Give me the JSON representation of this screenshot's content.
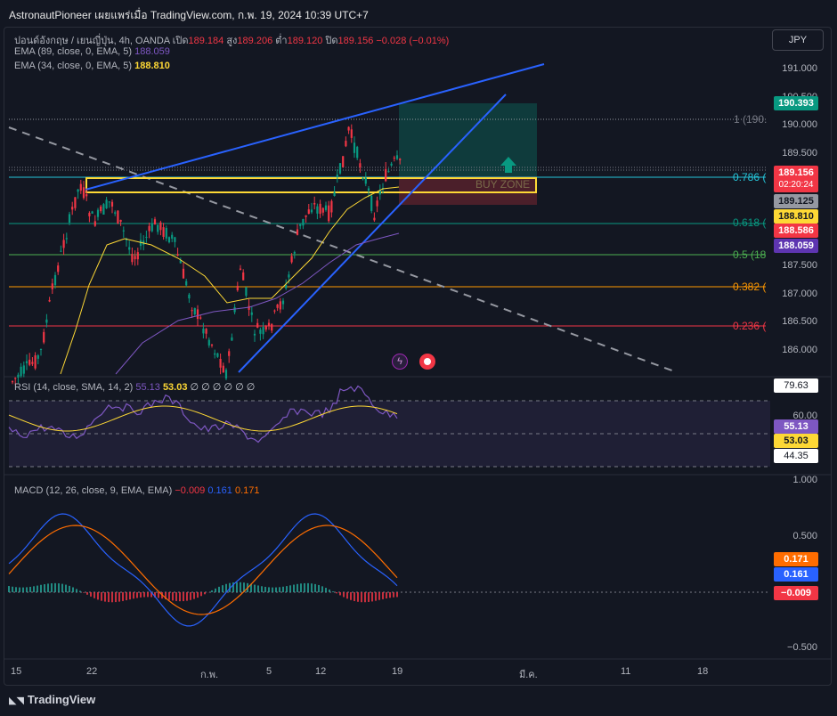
{
  "header": {
    "title": "AstronautPioneer เผยแพร่เมื่อ TradingView.com, ก.พ. 19, 2024 10:39 UTC+7"
  },
  "legend": {
    "symbol": "ปอนด์อังกฤษ / เยนญี่ปุ่น, 4h, OANDA",
    "open_label": "เปิด",
    "open": "189.184",
    "high_label": "สูง",
    "high": "189.206",
    "low_label": "ต่ำ",
    "low": "189.120",
    "close_label": "ปิด",
    "close": "189.156",
    "change": "−0.028 (−0.01%)",
    "ema89_label": "EMA (89, close, 0, EMA, 5)",
    "ema89": "188.059",
    "ema34_label": "EMA (34, close, 0, EMA, 5)",
    "ema34": "188.810"
  },
  "currency_button": "JPY",
  "price_axis": [
    "191.000",
    "190.500",
    "190.000",
    "189.500",
    "187.500",
    "187.000",
    "186.500",
    "186.000"
  ],
  "price_tags": {
    "target": "190.393",
    "last": "189.156",
    "countdown": "02:20:24",
    "p189125": "189.125",
    "ema34": "188.810",
    "p188586": "188.586",
    "ema89": "188.059"
  },
  "fib": {
    "f1": "1 (190.",
    "f786": "0.786 (",
    "f618": "0.618 (",
    "f5": "0.5 (18",
    "f382": "0.382 (",
    "f236": "0.236 ("
  },
  "buy_zone": "BUY ZONE",
  "rsi": {
    "label": "RSI (14, close, SMA, 14, 2)",
    "v1": "55.13",
    "v2": "53.03",
    "extras": "∅ ∅ ∅ ∅ ∅ ∅",
    "axis": [
      "79.63",
      "60.00",
      "44.35"
    ],
    "tag1": "55.13",
    "tag2": "53.03"
  },
  "macd": {
    "label": "MACD (12, 26, close, 9, EMA, EMA)",
    "hist": "−0.009",
    "macd": "0.161",
    "signal": "0.171",
    "axis": [
      "1.000",
      "0.500",
      "−0.500"
    ],
    "tag_signal": "0.171",
    "tag_macd": "0.161",
    "tag_hist": "−0.009"
  },
  "x_axis": [
    "15",
    "22",
    "ก.พ.",
    "5",
    "12",
    "19",
    "มี.ค.",
    "11",
    "18"
  ],
  "footer": {
    "logo": "TradingView"
  },
  "colors": {
    "bg": "#131722",
    "up": "#089981",
    "down": "#f23645",
    "ema34": "#fdd835",
    "ema89": "#7e57c2",
    "trend": "#2962ff",
    "rsi": "#7e57c2",
    "macd": "#2962ff",
    "signal": "#ff6d00"
  }
}
